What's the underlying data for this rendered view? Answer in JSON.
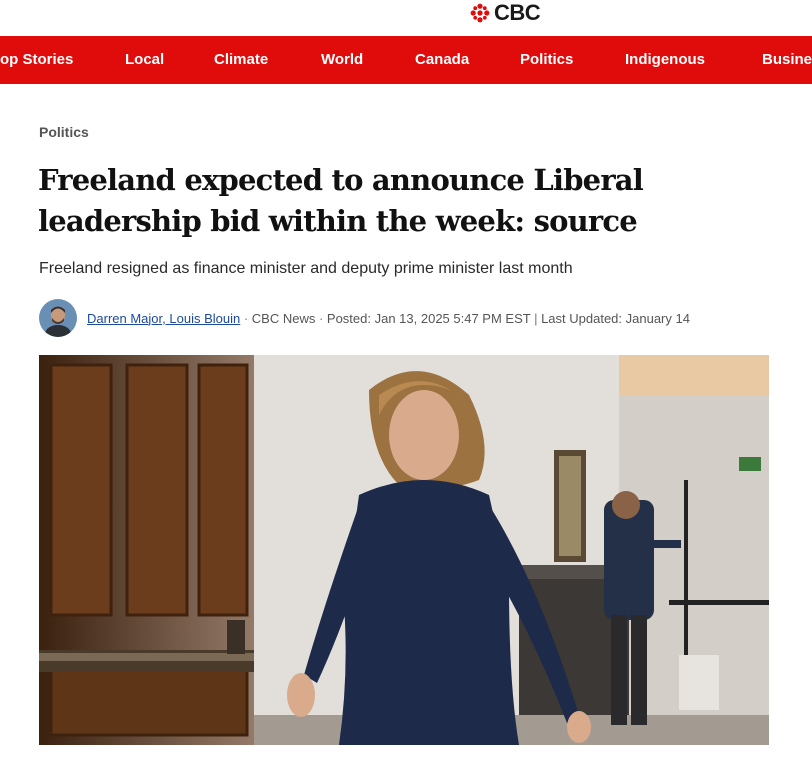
{
  "site": {
    "logo_text": "CBC",
    "brand_color": "#e00b0b"
  },
  "nav": {
    "items": [
      {
        "id": "top-stories",
        "label": "op Stories"
      },
      {
        "id": "local",
        "label": "Local"
      },
      {
        "id": "climate",
        "label": "Climate"
      },
      {
        "id": "world",
        "label": "World"
      },
      {
        "id": "canada",
        "label": "Canada"
      },
      {
        "id": "politics",
        "label": "Politics"
      },
      {
        "id": "indigenous",
        "label": "Indigenous"
      },
      {
        "id": "business",
        "label": "Busine"
      }
    ]
  },
  "article": {
    "section": "Politics",
    "headline": "Freeland expected to announce Liberal leadership bid within the week: source",
    "deck": "Freeland resigned as finance minister and deputy prime minister last month",
    "byline": {
      "author_1": "Darren Major",
      "comma": ", ",
      "author_2": "Louis Blouin",
      "separator_1": " · ",
      "outlet": "CBC News",
      "separator_2": " · ",
      "posted": "Posted: Jan 13, 2025 5:47 PM EST",
      "separator_3": " | ",
      "updated": "Last Updated: January 14"
    }
  }
}
